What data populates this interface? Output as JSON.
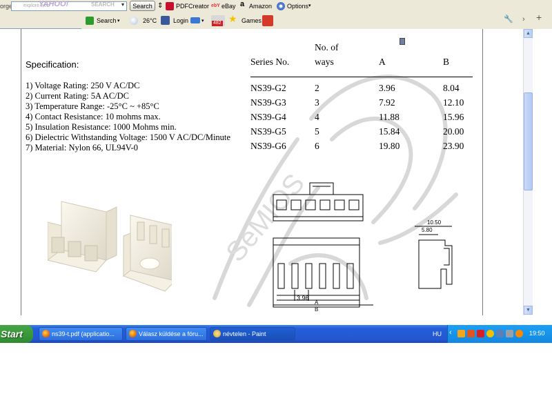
{
  "toolbar1": {
    "left_fragment": "orge",
    "search_placeholder": "explore.web",
    "yahoo_logo": "YAHOO!",
    "yahoo_search_label": "SEARCH",
    "search_button": "Search",
    "pdfcreator": "PDFCreator",
    "ebay": "eBay",
    "amazon": "Amazon",
    "options": "Options"
  },
  "toolbar2": {
    "search_label": "Search",
    "temperature": "26°C",
    "login": "Login",
    "mail_badge": "482",
    "games": "Games"
  },
  "spec": {
    "title": "Specification:",
    "lines": [
      "1) Voltage Rating: 250 V AC/DC",
      "2) Current Rating: 5A AC/DC",
      "3) Temperature Range: -25°C ~ +85°C",
      "4) Contact Resistance: 10 mohms max.",
      "5) Insulation Resistance: 1000 Mohms min.",
      "6) Dielectric Withstanding Voltage: 1500 V AC/DC/Minute",
      "7) Material: Nylon 66, UL94V-0"
    ]
  },
  "table": {
    "headers": {
      "series": "Series  No.",
      "ways_line1": "No. of",
      "ways_line2": "ways",
      "a": "A",
      "b": "B"
    },
    "rows": [
      {
        "series": "NS39-G2",
        "ways": "2",
        "a": "3.96",
        "b": "8.04"
      },
      {
        "series": "NS39-G3",
        "ways": "3",
        "a": "7.92",
        "b": "12.10"
      },
      {
        "series": "NS39-G4",
        "ways": "4",
        "a": "11.88",
        "b": "15.96"
      },
      {
        "series": "NS39-G5",
        "ways": "5",
        "a": "15.84",
        "b": "20.00"
      },
      {
        "series": "NS39-G6",
        "ways": "6",
        "a": "19.80",
        "b": "23.90"
      }
    ]
  },
  "drawing": {
    "dim_pitch": "3.96",
    "dim_a": "A",
    "dim_b": "B",
    "dim_1050": "10.50",
    "dim_580": "5.80"
  },
  "taskbar": {
    "start": "Start",
    "tasks": [
      "ns39-t.pdf (applicatio...",
      "Válasz küldése a fóru...",
      "névtelen - Paint"
    ],
    "lang": "HU",
    "clock": "19:50"
  },
  "colors": {
    "toolbar_bg": "#ece9d8",
    "taskbar_blue": "#245edb",
    "start_green": "#3a9a3a",
    "tray_blue": "#1487e0"
  }
}
